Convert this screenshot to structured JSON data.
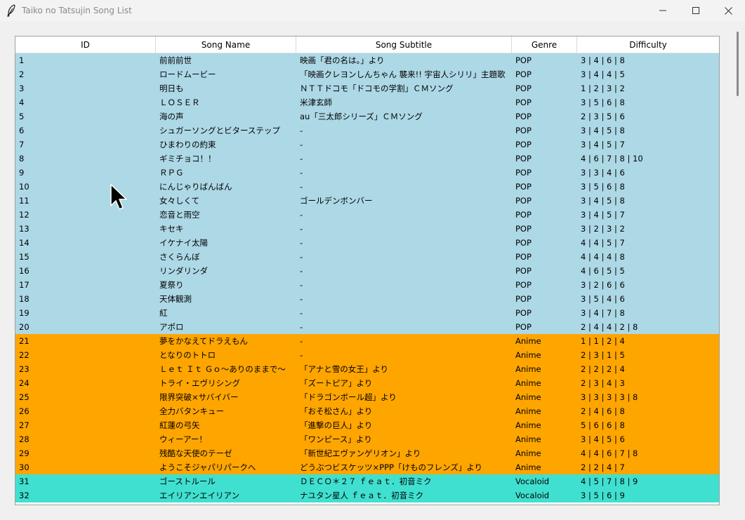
{
  "window": {
    "title": "Taiko no Tatsujin Song List",
    "app_icon": "feather-icon",
    "controls": [
      "minimize-icon",
      "maximize-icon",
      "close-icon"
    ]
  },
  "table": {
    "columns": [
      "ID",
      "Song Name",
      "Song Subtitle",
      "Genre",
      "Difficulty"
    ],
    "genre_colors": {
      "POP": "#add8e6",
      "Anime": "#ffa500",
      "Vocaloid": "#40e0d0"
    },
    "rows": [
      {
        "id": "1",
        "name": "前前前世",
        "subtitle": "映画「君の名は。」より",
        "genre": "POP",
        "difficulty": "3 | 4 | 6 | 8"
      },
      {
        "id": "2",
        "name": "ロードムービー",
        "subtitle": "「映画クレヨンしんちゃん 襲来!! 宇宙人シリリ」主題歌",
        "genre": "POP",
        "difficulty": "3 | 4 | 4 | 5"
      },
      {
        "id": "3",
        "name": "明日も",
        "subtitle": "ＮＴＴドコモ「ドコモの学割」ＣＭソング",
        "genre": "POP",
        "difficulty": "1 | 2 | 3 | 2"
      },
      {
        "id": "4",
        "name": "ＬＯＳＥＲ",
        "subtitle": "米津玄師",
        "genre": "POP",
        "difficulty": "3 | 5 | 6 | 8"
      },
      {
        "id": "5",
        "name": "海の声",
        "subtitle": "au「三太郎シリーズ」ＣＭソング",
        "genre": "POP",
        "difficulty": "2 | 3 | 5 | 6"
      },
      {
        "id": "6",
        "name": "シュガーソングとビターステップ",
        "subtitle": "-",
        "genre": "POP",
        "difficulty": "3 | 4 | 5 | 8"
      },
      {
        "id": "7",
        "name": "ひまわりの約束",
        "subtitle": "-",
        "genre": "POP",
        "difficulty": "3 | 4 | 5 | 7"
      },
      {
        "id": "8",
        "name": "ギミチョコ！！",
        "subtitle": "-",
        "genre": "POP",
        "difficulty": "4 | 6 | 7 | 8 | 10"
      },
      {
        "id": "9",
        "name": "ＲＰＧ",
        "subtitle": "-",
        "genre": "POP",
        "difficulty": "3 | 3 | 4 | 6"
      },
      {
        "id": "10",
        "name": "にんじゃりばんばん",
        "subtitle": "-",
        "genre": "POP",
        "difficulty": "3 | 5 | 6 | 8"
      },
      {
        "id": "11",
        "name": "女々しくて",
        "subtitle": "ゴールデンボンバー",
        "genre": "POP",
        "difficulty": "3 | 4 | 5 | 8"
      },
      {
        "id": "12",
        "name": "恋音と雨空",
        "subtitle": "-",
        "genre": "POP",
        "difficulty": "3 | 4 | 5 | 7"
      },
      {
        "id": "13",
        "name": "キセキ",
        "subtitle": "-",
        "genre": "POP",
        "difficulty": "3 | 2 | 3 | 2"
      },
      {
        "id": "14",
        "name": "イケナイ太陽",
        "subtitle": "-",
        "genre": "POP",
        "difficulty": "4 | 4 | 5 | 7"
      },
      {
        "id": "15",
        "name": "さくらんぼ",
        "subtitle": "-",
        "genre": "POP",
        "difficulty": "4 | 4 | 4 | 8"
      },
      {
        "id": "16",
        "name": "リンダリンダ",
        "subtitle": "-",
        "genre": "POP",
        "difficulty": "4 | 6 | 5 | 5"
      },
      {
        "id": "17",
        "name": "夏祭り",
        "subtitle": "-",
        "genre": "POP",
        "difficulty": "3 | 2 | 6 | 6"
      },
      {
        "id": "18",
        "name": "天体観測",
        "subtitle": "-",
        "genre": "POP",
        "difficulty": "3 | 5 | 4 | 6"
      },
      {
        "id": "19",
        "name": "紅",
        "subtitle": "-",
        "genre": "POP",
        "difficulty": "3 | 4 | 7 | 8"
      },
      {
        "id": "20",
        "name": "アポロ",
        "subtitle": "-",
        "genre": "POP",
        "difficulty": "2 | 4 | 4 | 2 | 8"
      },
      {
        "id": "21",
        "name": "夢をかなえてドラえもん",
        "subtitle": "-",
        "genre": "Anime",
        "difficulty": "1 | 1 | 2 | 4"
      },
      {
        "id": "22",
        "name": "となりのトトロ",
        "subtitle": "-",
        "genre": "Anime",
        "difficulty": "2 | 3 | 1 | 5"
      },
      {
        "id": "23",
        "name": "Ｌｅｔ Ｉｔ Ｇｏ～ありのままで～",
        "subtitle": "「アナと雪の女王」より",
        "genre": "Anime",
        "difficulty": "2 | 2 | 2 | 4"
      },
      {
        "id": "24",
        "name": "トライ・エヴリシング",
        "subtitle": "「ズートピア」より",
        "genre": "Anime",
        "difficulty": "2 | 3 | 4 | 3"
      },
      {
        "id": "25",
        "name": "限界突破×サバイバー",
        "subtitle": "「ドラゴンボール超」より",
        "genre": "Anime",
        "difficulty": "3 | 3 | 3 | 3 | 8"
      },
      {
        "id": "26",
        "name": "全力バタンキュー",
        "subtitle": "「おそ松さん」より",
        "genre": "Anime",
        "difficulty": "2 | 4 | 6 | 8"
      },
      {
        "id": "27",
        "name": "紅蓮の弓矢",
        "subtitle": "「進撃の巨人」より",
        "genre": "Anime",
        "difficulty": "5 | 6 | 6 | 8"
      },
      {
        "id": "28",
        "name": "ウィーアー！",
        "subtitle": "「ワンピース」より",
        "genre": "Anime",
        "difficulty": "3 | 4 | 5 | 6"
      },
      {
        "id": "29",
        "name": "残酷な天使のテーゼ",
        "subtitle": "「新世紀エヴァンゲリオン」より",
        "genre": "Anime",
        "difficulty": "4 | 4 | 6 | 7 | 8"
      },
      {
        "id": "30",
        "name": "ようこそジャパリパークへ",
        "subtitle": "どうぶつビスケッツ×PPP「けものフレンズ」より",
        "genre": "Anime",
        "difficulty": "2 | 2 | 4 | 7"
      },
      {
        "id": "31",
        "name": "ゴーストルール",
        "subtitle": "ＤＥＣＯ＊２７ ｆｅａｔ．初音ミク",
        "genre": "Vocaloid",
        "difficulty": "4 | 5 | 7 | 8 | 9"
      },
      {
        "id": "32",
        "name": "エイリアンエイリアン",
        "subtitle": "ナユタン星人 ｆｅａｔ．初音ミク",
        "genre": "Vocaloid",
        "difficulty": "3 | 5 | 6 | 9"
      }
    ]
  }
}
